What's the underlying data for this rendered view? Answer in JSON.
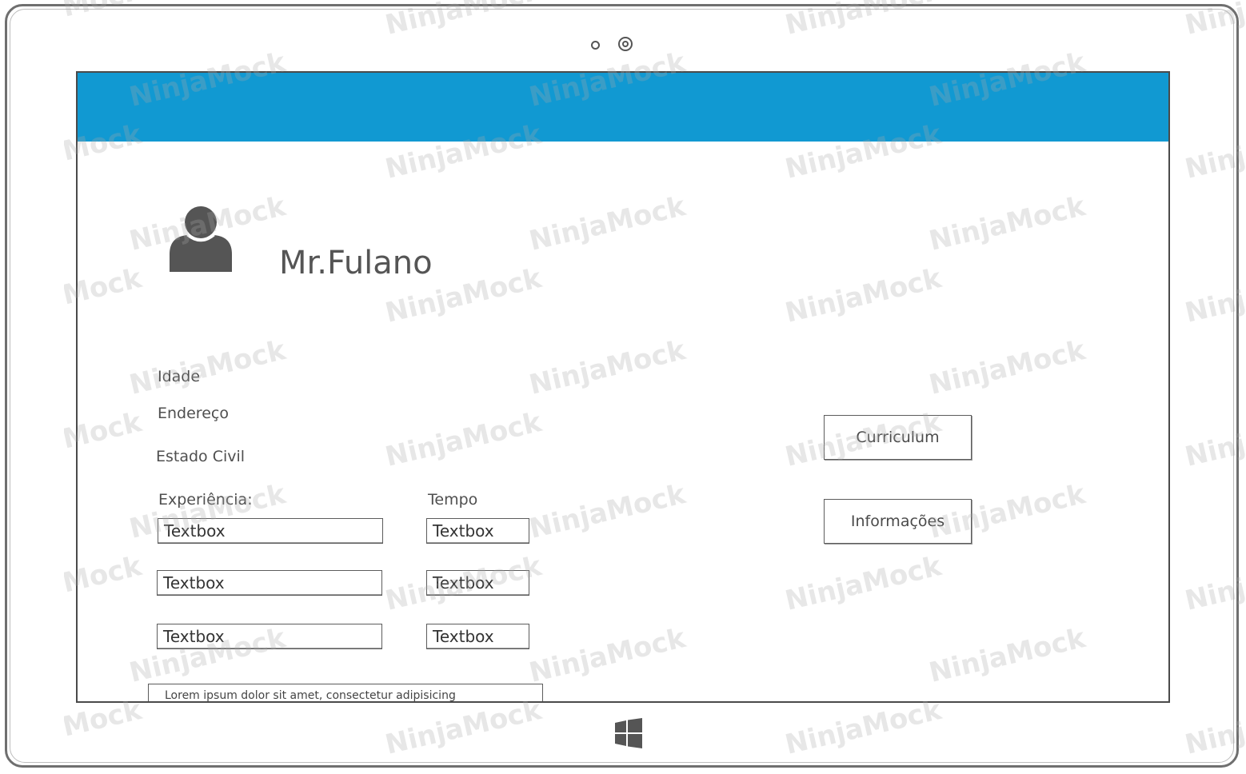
{
  "colors": {
    "header_bar": "#1199d2",
    "frame": "#6f6f6f",
    "text": "#4f4f4f"
  },
  "profile": {
    "avatar_icon": "user-silhouette-icon",
    "name": "Mr.Fulano"
  },
  "fields": {
    "idade": "Idade",
    "endereco": "Endereço",
    "estado_civil": "Estado Civil"
  },
  "experience": {
    "experience_label": "Experiência:",
    "tempo_label": "Tempo",
    "rows": [
      {
        "experience": "Textbox",
        "tempo": "Textbox"
      },
      {
        "experience": "Textbox",
        "tempo": "Textbox"
      },
      {
        "experience": "Textbox",
        "tempo": "Textbox"
      }
    ]
  },
  "buttons": {
    "curriculum": "Curriculum",
    "informacoes": "Informações"
  },
  "description": "Lorem ipsum dolor sit amet, consectetur adipisicing",
  "watermark": "NinjaMock",
  "device": {
    "start_icon": "windows-logo-icon",
    "camera_icons": [
      "camera-dot-icon",
      "camera-lens-icon"
    ]
  }
}
